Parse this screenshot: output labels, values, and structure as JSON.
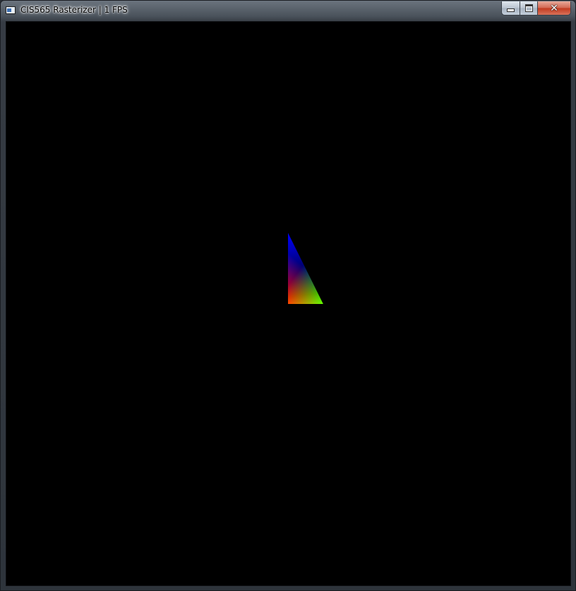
{
  "window": {
    "title": "CIS565 Rasterizer | 1 FPS",
    "icon": "app-window-icon",
    "controls": {
      "minimize": "minimize-icon",
      "maximize": "maximize-icon",
      "close": "close-icon",
      "close_glyph": "✕"
    }
  },
  "viewport": {
    "background": "#000000",
    "triangle": {
      "vertex_colors": {
        "top": "#0000ff",
        "bottom_left": "#ff0000",
        "bottom_right": "#00ff00"
      }
    }
  }
}
